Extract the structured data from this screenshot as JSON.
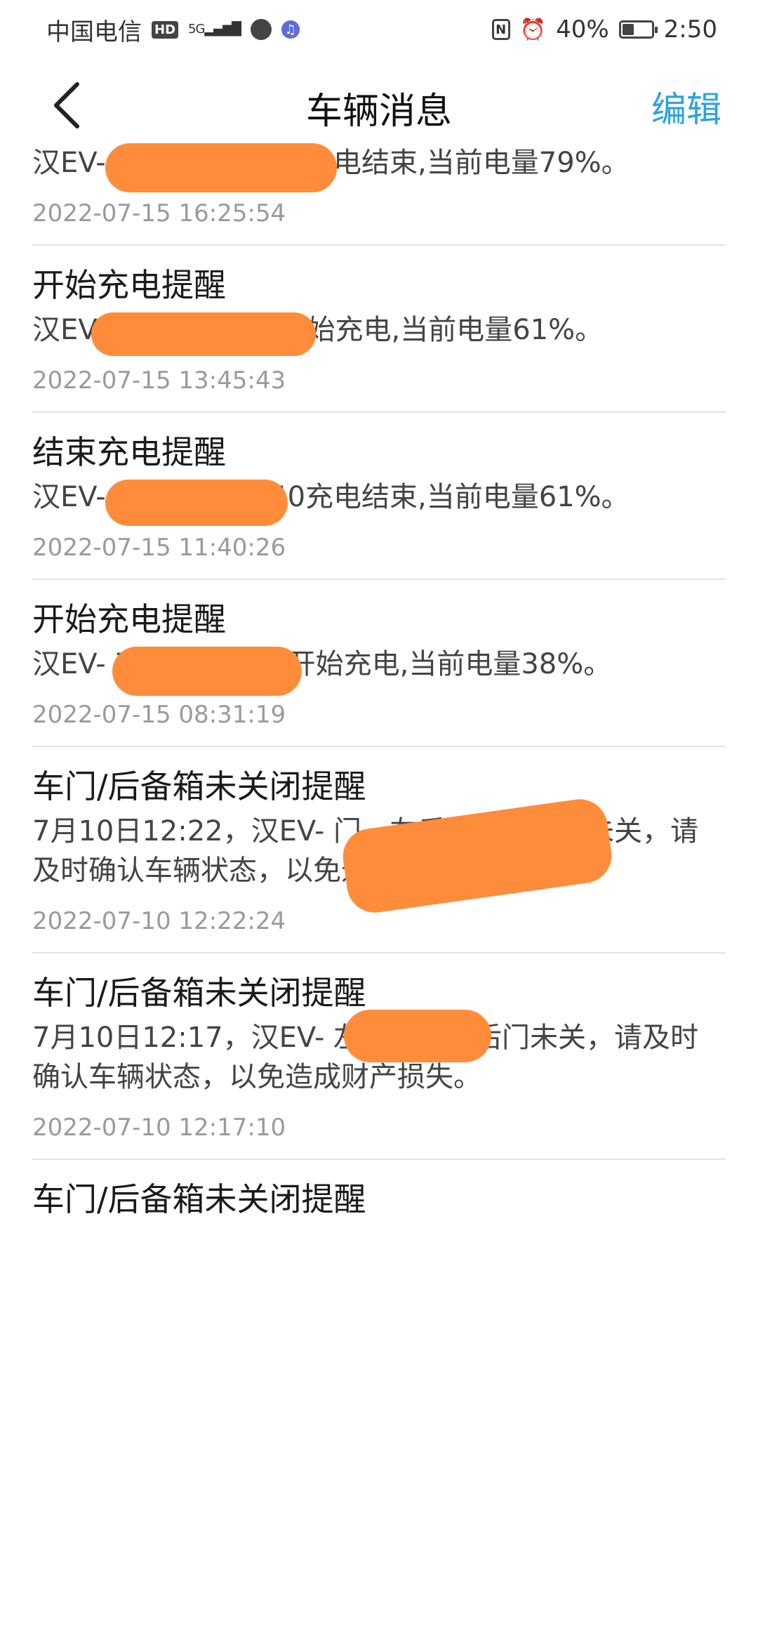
{
  "status_bar": {
    "carrier": "中国电信",
    "hd": "HD",
    "network": "5G",
    "battery_percent": "40%",
    "battery_level": 0.4,
    "time": "2:50"
  },
  "nav": {
    "title": "车辆消息",
    "edit_label": "编辑"
  },
  "messages": [
    {
      "title": "",
      "body": "汉EV-                          7月15日16:25充电结束,当前电量79%。",
      "time": "2022-07-15 16:25:54"
    },
    {
      "title": "开始充电提醒",
      "body": "汉EV                              月15日13:45开始充电,当前电量61%。",
      "time": "2022-07-15 13:45:43"
    },
    {
      "title": "结束充电提醒",
      "body": "汉EV-                         7月15日11:40充电结束,当前电量61%。",
      "time": "2022-07-15 11:40:26"
    },
    {
      "title": "开始充电提醒",
      "body": "汉EV-                          7月15日8:31开始充电,当前电量38%。",
      "time": "2022-07-15 08:31:19"
    },
    {
      "title": "车门/后备箱未关闭提醒",
      "body": "7月10日12:22，汉EV-                      门、左后门、右后门未关，请及时确认车辆状态，以免造成财产损失。",
      "time": "2022-07-10 12:22:24"
    },
    {
      "title": "车门/后备箱未关闭提醒",
      "body": "7月10日12:17，汉EV-                 左前门、右后门未关，请及时确认车辆状态，以免造成财产损失。",
      "time": "2022-07-10 12:17:10"
    },
    {
      "title": "车门/后备箱未关闭提醒",
      "body": "",
      "time": ""
    }
  ],
  "colors": {
    "accent": "#2aa3e0",
    "redaction": "#ff8c3a"
  }
}
